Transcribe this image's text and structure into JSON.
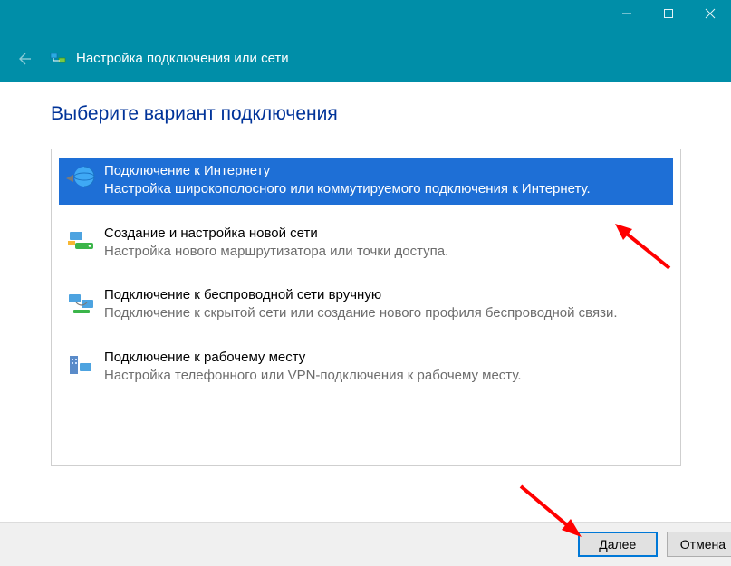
{
  "window": {
    "title": "Настройка подключения или сети"
  },
  "page": {
    "heading": "Выберите вариант подключения"
  },
  "options": [
    {
      "title": "Подключение к Интернету",
      "desc": "Настройка широкополосного или коммутируемого подключения к Интернету."
    },
    {
      "title": "Создание и настройка новой сети",
      "desc": "Настройка нового маршрутизатора или точки доступа."
    },
    {
      "title": "Подключение к беспроводной сети вручную",
      "desc": "Подключение к скрытой сети или создание нового профиля беспроводной связи."
    },
    {
      "title": "Подключение к рабочему месту",
      "desc": "Настройка телефонного или VPN-подключения к рабочему месту."
    }
  ],
  "buttons": {
    "next": "Далее",
    "cancel": "Отмена"
  }
}
